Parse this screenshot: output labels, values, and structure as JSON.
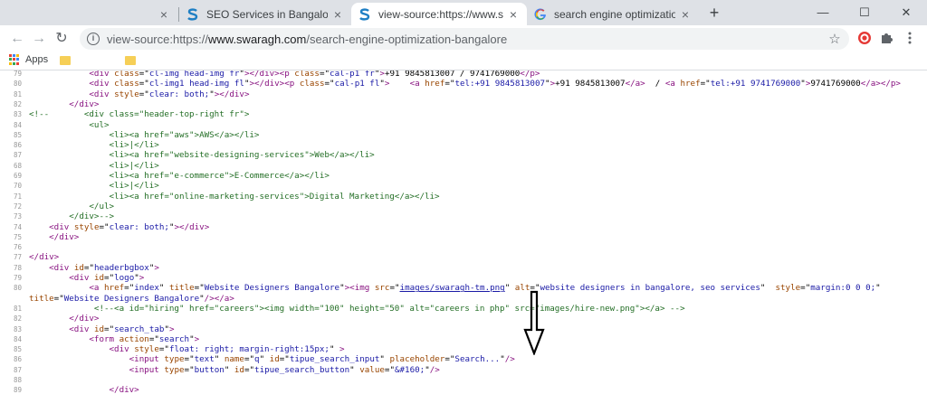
{
  "tabs": [
    {
      "title": "",
      "favicon": "blank-favicon",
      "active": false
    },
    {
      "title": "SEO Services in Bangalore | Search",
      "favicon": "swaragh-favicon",
      "active": false
    },
    {
      "title": "view-source:https://www.swaragh",
      "favicon": "swaragh-favicon",
      "active": true
    },
    {
      "title": "search engine optimization bang",
      "favicon": "google-favicon",
      "active": false
    }
  ],
  "tab_close_glyph": "×",
  "new_tab_glyph": "+",
  "window_controls": {
    "minimize": "—",
    "maximize": "☐",
    "close": "✕"
  },
  "toolbar": {
    "back_glyph": "←",
    "forward_glyph": "→",
    "reload_glyph": "↻",
    "url_prefix": "view-source:https://",
    "url_host": "www.swaragh.com",
    "url_path": "/search-engine-optimization-bangalore",
    "star_glyph": "☆"
  },
  "bookmarks": {
    "apps_label": "Apps"
  },
  "colors": {
    "tag": "#881280",
    "attr_name": "#994500",
    "attr_value": "#1a1aa6",
    "comment": "#236e25",
    "line_number": "#999999",
    "swaragh_brand": "#1f7fc4"
  },
  "source_lines": [
    {
      "n": "79",
      "html": "            <span class=\"t\">&lt;div</span> <span class=\"an\">class</span>=\"<span class=\"av\">cl-img head-img fr</span>\"<span class=\"t\">&gt;&lt;/div&gt;&lt;p</span> <span class=\"an\">class</span>=\"<span class=\"av\">cal-p1 fr</span>\"<span class=\"t\">&gt;</span>+91 9845813007 / 9741769000<span class=\"t\">&lt;/p&gt;</span>"
    },
    {
      "n": "80",
      "html": "            <span class=\"t\">&lt;div</span> <span class=\"an\">class</span>=\"<span class=\"av\">cl-img1 head-img fl</span>\"<span class=\"t\">&gt;&lt;/div&gt;&lt;p</span> <span class=\"an\">class</span>=\"<span class=\"av\">cal-p1 fl</span>\"<span class=\"t\">&gt;</span>    <span class=\"t\">&lt;a</span> <span class=\"an\">href</span>=\"<span class=\"av\">tel:+91 9845813007</span>\"<span class=\"t\">&gt;</span>+91 9845813007<span class=\"t\">&lt;/a&gt;</span>  / <span class=\"t\">&lt;a</span> <span class=\"an\">href</span>=\"<span class=\"av\">tel:+91 9741769000</span>\"<span class=\"t\">&gt;</span>9741769000<span class=\"t\">&lt;/a&gt;&lt;/p&gt;</span>"
    },
    {
      "n": "81",
      "html": "            <span class=\"t\">&lt;div</span> <span class=\"an\">style</span>=\"<span class=\"av\">clear: both;</span>\"<span class=\"t\">&gt;&lt;/div&gt;</span>"
    },
    {
      "n": "82",
      "html": "        <span class=\"t\">&lt;/div&gt;</span>"
    },
    {
      "n": "83",
      "html": "<span class=\"cm\">&lt;!--       &lt;div class=\"header-top-right fr\"&gt;</span>"
    },
    {
      "n": "84",
      "html": "<span class=\"cm\">            &lt;ul&gt;</span>"
    },
    {
      "n": "85",
      "html": "<span class=\"cm\">                &lt;li&gt;&lt;a href=\"aws\"&gt;AWS&lt;/a&gt;&lt;/li&gt;</span>"
    },
    {
      "n": "86",
      "html": "<span class=\"cm\">                &lt;li&gt;|&lt;/li&gt;</span>"
    },
    {
      "n": "87",
      "html": "<span class=\"cm\">                &lt;li&gt;&lt;a href=\"website-designing-services\"&gt;Web&lt;/a&gt;&lt;/li&gt;</span>"
    },
    {
      "n": "68",
      "html": "<span class=\"cm\">                &lt;li&gt;|&lt;/li&gt;</span>"
    },
    {
      "n": "69",
      "html": "<span class=\"cm\">                &lt;li&gt;&lt;a href=\"e-commerce\"&gt;E-Commerce&lt;/a&gt;&lt;/li&gt;</span>"
    },
    {
      "n": "70",
      "html": "<span class=\"cm\">                &lt;li&gt;|&lt;/li&gt;</span>"
    },
    {
      "n": "71",
      "html": "<span class=\"cm\">                &lt;li&gt;&lt;a href=\"online-marketing-services\"&gt;Digital Marketing&lt;/a&gt;&lt;/li&gt;</span>"
    },
    {
      "n": "72",
      "html": "<span class=\"cm\">            &lt;/ul&gt;</span>"
    },
    {
      "n": "73",
      "html": "<span class=\"cm\">        &lt;/div&gt;--&gt;</span>"
    },
    {
      "n": "74",
      "html": "    <span class=\"t\">&lt;div</span> <span class=\"an\">style</span>=\"<span class=\"av\">clear: both;</span>\"<span class=\"t\">&gt;&lt;/div&gt;</span>"
    },
    {
      "n": "75",
      "html": "    <span class=\"t\">&lt;/div&gt;</span>"
    },
    {
      "n": "76",
      "html": ""
    },
    {
      "n": "77",
      "html": "<span class=\"t\">&lt;/div&gt;</span>"
    },
    {
      "n": "78",
      "html": "    <span class=\"t\">&lt;div</span> <span class=\"an\">id</span>=\"<span class=\"av\">headerbgbox</span>\"<span class=\"t\">&gt;</span>"
    },
    {
      "n": "79",
      "html": "        <span class=\"t\">&lt;div</span> <span class=\"an\">id</span>=\"<span class=\"av\">logo</span>\"<span class=\"t\">&gt;</span>"
    },
    {
      "n": "80",
      "html": "            <span class=\"t\">&lt;a</span> <span class=\"an\">href</span>=\"<span class=\"av\">index</span>\" <span class=\"an\">title</span>=\"<span class=\"av\">Website Designers Bangalore</span>\"<span class=\"t\">&gt;&lt;img</span> <span class=\"an\">src</span>=\"<span class=\"lk\">images/swaragh-tm.png</span>\" <span class=\"an\">alt</span>=\"<span class=\"av\">website designers in bangalore, seo services</span>\"  <span class=\"an\">style</span>=\"<span class=\"av\">margin:0 0 0;</span>\""
    },
    {
      "n": "",
      "html": "<span class=\"an\">title</span>=\"<span class=\"av\">Website Designers Bangalore</span>\"<span class=\"t\">/&gt;&lt;/a&gt;</span>"
    },
    {
      "n": "81",
      "html": "             <span class=\"cm\">&lt;!--&lt;a id=\"hiring\" href=\"careers\"&gt;&lt;img width=\"100\" height=\"50\" alt=\"careers in php\" src=\"images/hire-new.png\"&gt;&lt;/a&gt; --&gt;</span>"
    },
    {
      "n": "82",
      "html": "        <span class=\"t\">&lt;/div&gt;</span>"
    },
    {
      "n": "83",
      "html": "        <span class=\"t\">&lt;div</span> <span class=\"an\">id</span>=\"<span class=\"av\">search_tab</span>\"<span class=\"t\">&gt;</span>"
    },
    {
      "n": "84",
      "html": "            <span class=\"t\">&lt;form</span> <span class=\"an\">action</span>=\"<span class=\"av\">search</span>\"<span class=\"t\">&gt;</span>"
    },
    {
      "n": "85",
      "html": "                <span class=\"t\">&lt;div</span> <span class=\"an\">style</span>=\"<span class=\"av\">float: right; margin-right:15px;</span>\" <span class=\"t\">&gt;</span>"
    },
    {
      "n": "86",
      "html": "                    <span class=\"t\">&lt;input</span> <span class=\"an\">type</span>=\"<span class=\"av\">text</span>\" <span class=\"an\">name</span>=\"<span class=\"av\">q</span>\" <span class=\"an\">id</span>=\"<span class=\"av\">tipue_search_input</span>\" <span class=\"an\">placeholder</span>=\"<span class=\"av\">Search...</span>\"<span class=\"t\">/&gt;</span>"
    },
    {
      "n": "87",
      "html": "                    <span class=\"t\">&lt;input</span> <span class=\"an\">type</span>=\"<span class=\"av\">button</span>\" <span class=\"an\">id</span>=\"<span class=\"av\">tipue_search_button</span>\" <span class=\"an\">value</span>=\"<span class=\"av\">&amp;#160;</span>\"<span class=\"t\">/&gt;</span>"
    },
    {
      "n": "88",
      "html": ""
    },
    {
      "n": "89",
      "html": "                <span class=\"t\">&lt;/div&gt;</span>"
    }
  ]
}
